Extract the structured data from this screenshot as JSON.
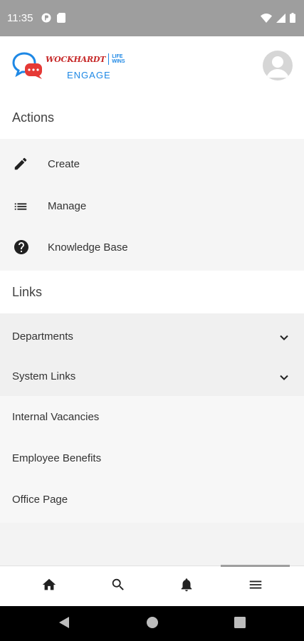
{
  "status_bar": {
    "time": "11:35"
  },
  "header": {
    "brand_name": "WOCKHARDT",
    "brand_tag_line1": "LIFE",
    "brand_tag_line2": "WINS",
    "brand_engage": "ENGAGE"
  },
  "actions": {
    "title": "Actions",
    "items": [
      {
        "label": "Create",
        "icon": "pencil-icon"
      },
      {
        "label": "Manage",
        "icon": "list-icon"
      },
      {
        "label": "Knowledge Base",
        "icon": "help-circle-icon"
      }
    ]
  },
  "links": {
    "title": "Links",
    "items": [
      {
        "label": "Departments",
        "expandable": true
      },
      {
        "label": "System Links",
        "expandable": true
      },
      {
        "label": "Internal Vacancies",
        "expandable": false
      },
      {
        "label": "Employee Benefits",
        "expandable": false
      },
      {
        "label": "Office Page",
        "expandable": false
      }
    ]
  },
  "bottom_nav": {
    "items": [
      "home-icon",
      "search-icon",
      "bell-icon",
      "menu-icon"
    ],
    "active": "menu-icon"
  },
  "colors": {
    "status_bar": "#9e9e9e",
    "brand_red": "#c62828",
    "brand_blue": "#1e88e5",
    "menu_bg": "#f5f5f5"
  }
}
